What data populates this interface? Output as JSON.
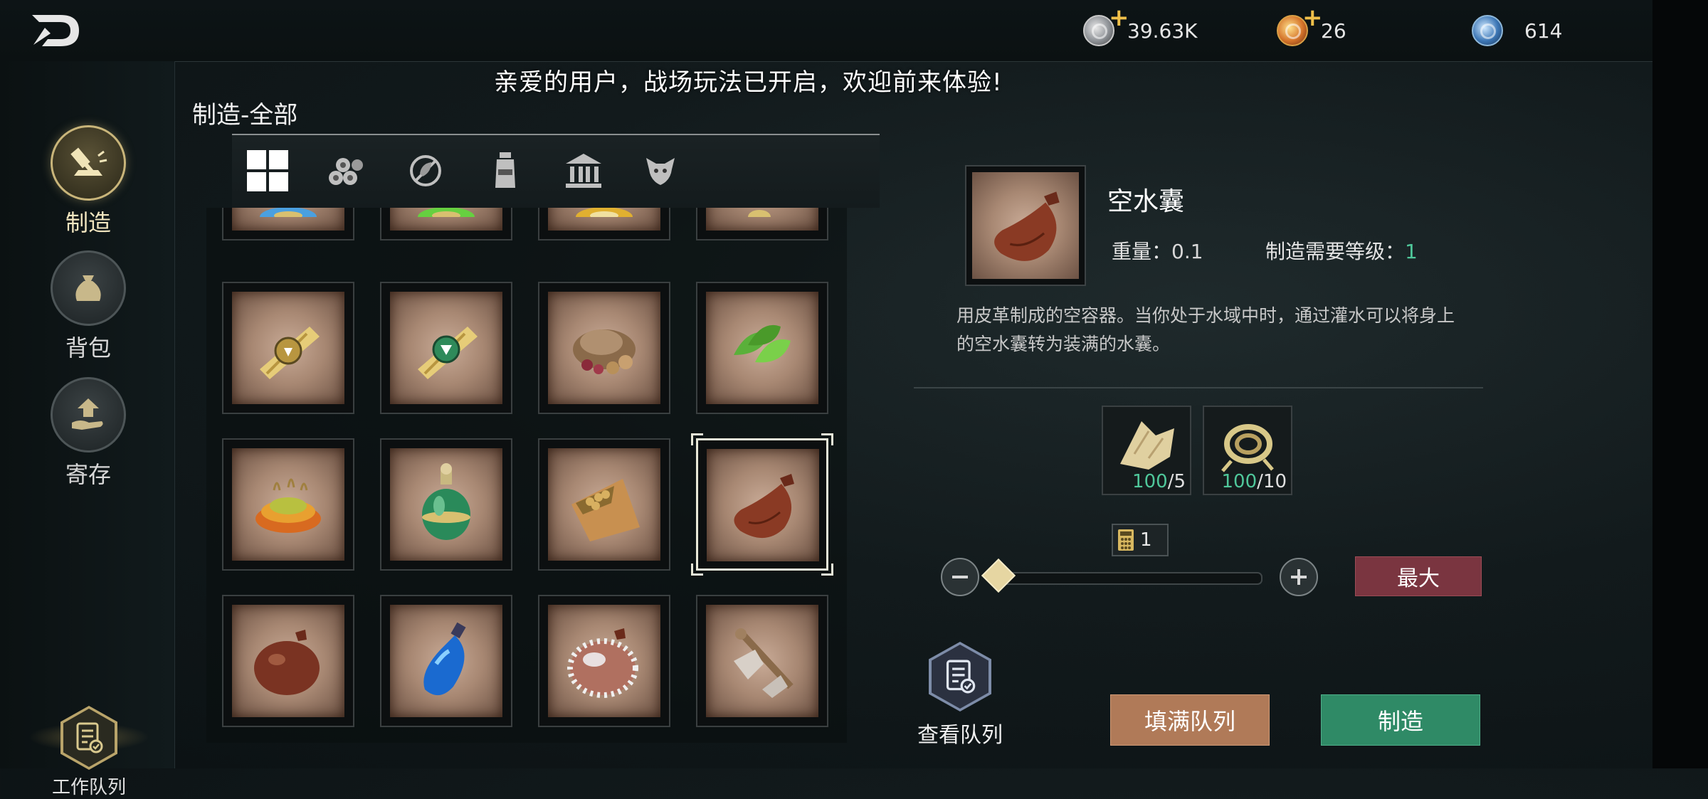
{
  "header": {
    "back_icon": "back-arrow-icon",
    "currencies": [
      {
        "name": "silver-coin",
        "value": "39.63K",
        "has_plus": true,
        "color": "#a9adb2"
      },
      {
        "name": "gold-coin",
        "value": "26",
        "has_plus": true,
        "color": "#d4732a"
      },
      {
        "name": "blue-gem",
        "value": "614",
        "has_plus": false,
        "color": "#3c76b5"
      }
    ]
  },
  "notice": "亲爱的用户，战场玩法已开启，欢迎前来体验!",
  "sidebar": {
    "items": [
      {
        "label": "制造",
        "icon": "hammer-anvil-icon",
        "active": true
      },
      {
        "label": "背包",
        "icon": "bag-icon",
        "active": false
      },
      {
        "label": "寄存",
        "icon": "storage-hand-icon",
        "active": false
      }
    ],
    "work_queue": {
      "label": "工作队列",
      "icon": "queue-list-icon"
    }
  },
  "craft": {
    "title": "制造-全部",
    "categories": [
      {
        "name": "all-grid-icon",
        "active": true
      },
      {
        "name": "logs-icon",
        "active": false
      },
      {
        "name": "disabled-leaf-icon",
        "active": false
      },
      {
        "name": "bottle-icon",
        "active": false
      },
      {
        "name": "building-icon",
        "active": false
      },
      {
        "name": "creature-icon",
        "active": false
      }
    ],
    "grid_rows": [
      [
        "blue-scroll-item",
        "green-scroll-item",
        "gold-scroll-item",
        "yellow-scroll-item"
      ],
      [
        "emblem-scroll-item",
        "green-seal-scroll-item",
        "mushroom-pile-item",
        "green-herb-item"
      ],
      [
        "roasted-seeds-item",
        "green-potion-item",
        "seed-pouch-item",
        "empty-waterskin-item"
      ],
      [
        "leather-waterskin-item",
        "blue-potion-item",
        "frost-waterskin-item",
        "bone-axe-item"
      ]
    ],
    "selected": "empty-waterskin-item"
  },
  "detail": {
    "name": "空水囊",
    "weight_label": "重量：",
    "weight_value": "0.1",
    "level_label": "制造需要等级：",
    "level_value": "1",
    "description": "用皮革制成的空容器。当你处于水域中时，通过灌水可以将身上的空水囊转为装满的水囊。",
    "materials": [
      {
        "icon": "leather-scrap-icon",
        "have": "100",
        "need": "/5"
      },
      {
        "icon": "rope-coil-icon",
        "have": "100",
        "need": "/10"
      }
    ],
    "quantity": "1",
    "slider_fraction": 0,
    "max_label": "最大",
    "view_queue_label": "查看队列",
    "fill_queue_label": "填满队列",
    "make_label": "制造",
    "colors": {
      "accent_green": "#4fc79a",
      "max_button": "#7a3540",
      "fill_button": "#b07a58",
      "make_button": "#2f8a66"
    }
  }
}
